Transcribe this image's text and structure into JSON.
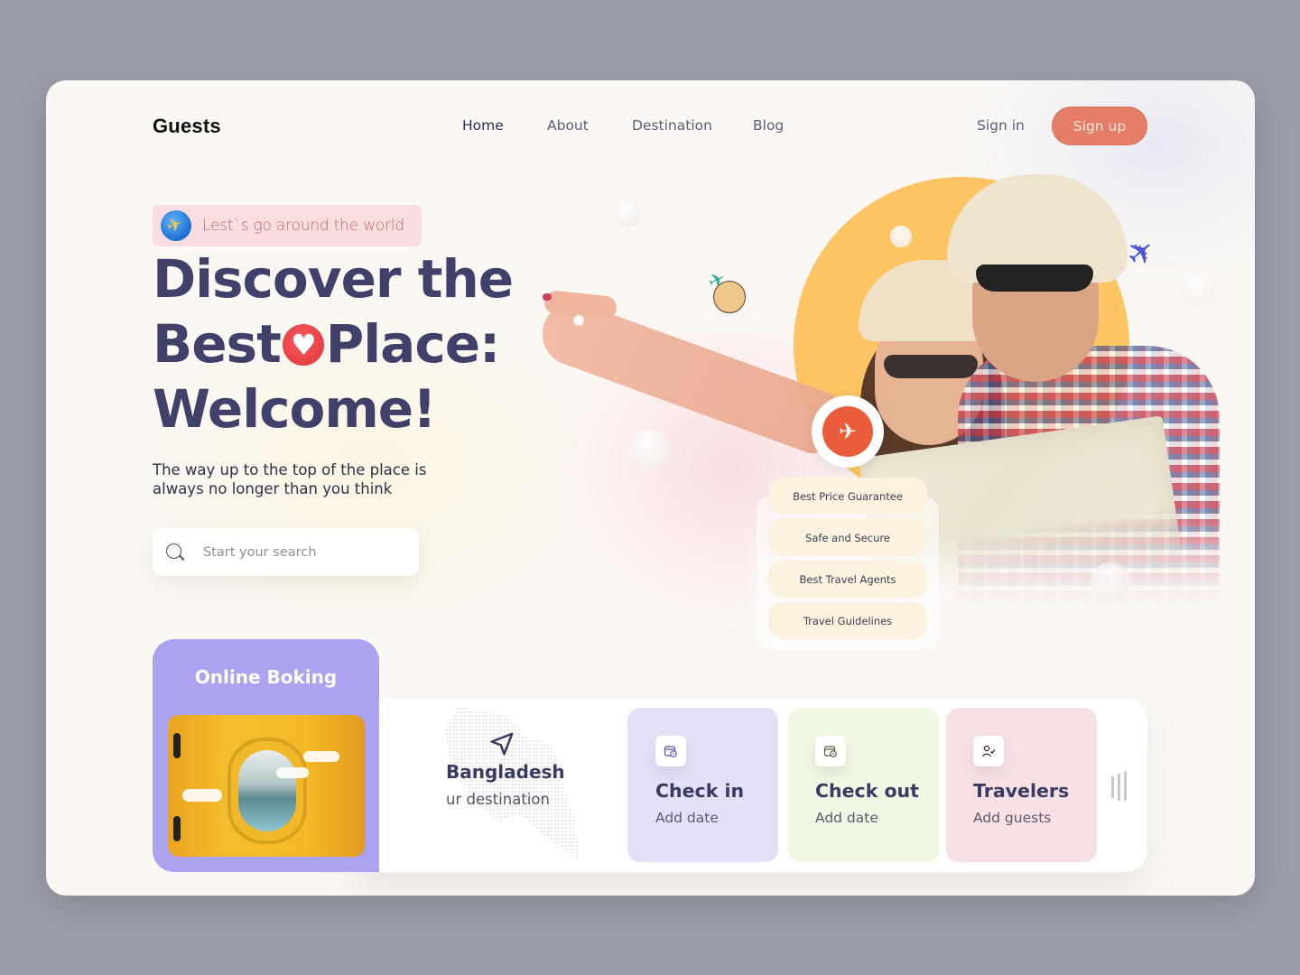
{
  "header": {
    "logo": "Guests",
    "nav": [
      {
        "label": "Home",
        "active": true
      },
      {
        "label": "About",
        "active": false
      },
      {
        "label": "Destination",
        "active": false
      },
      {
        "label": "Blog",
        "active": false
      }
    ],
    "sign_in": "Sign in",
    "sign_up": "Sign up"
  },
  "hero": {
    "tagline": "Lest`s go around the world",
    "headline": {
      "line1": "Discover the",
      "line2a": "Best",
      "line2b": "Place:",
      "line3": "Welcome!"
    },
    "subtitle_line1": "The way up to the top of the place is",
    "subtitle_line2": "always no longer than you think",
    "search": {
      "placeholder": "Start your search",
      "value": ""
    }
  },
  "features": [
    "Best Price Guarantee",
    "Safe and Secure",
    "Best Travel Agents",
    "Travel Guidelines"
  ],
  "booking": {
    "online_title": "Online Boking",
    "destination": {
      "name": "Bangladesh",
      "sub": "ur destination"
    },
    "cards": [
      {
        "title": "Check in",
        "sub": "Add date",
        "icon": "calendar-clock-icon"
      },
      {
        "title": "Check out",
        "sub": "Add date",
        "icon": "calendar-clock-icon"
      },
      {
        "title": "Travelers",
        "sub": "Add guests",
        "icon": "user-check-icon"
      }
    ]
  },
  "colors": {
    "accent": "#e47e66",
    "headline": "#40416a",
    "online_card": "#aca3f0",
    "checkin_card": "#e2e1f7",
    "checkout_card": "#eff8e3",
    "travelers_card": "#f7e1e3",
    "sun": "#fcc463"
  }
}
